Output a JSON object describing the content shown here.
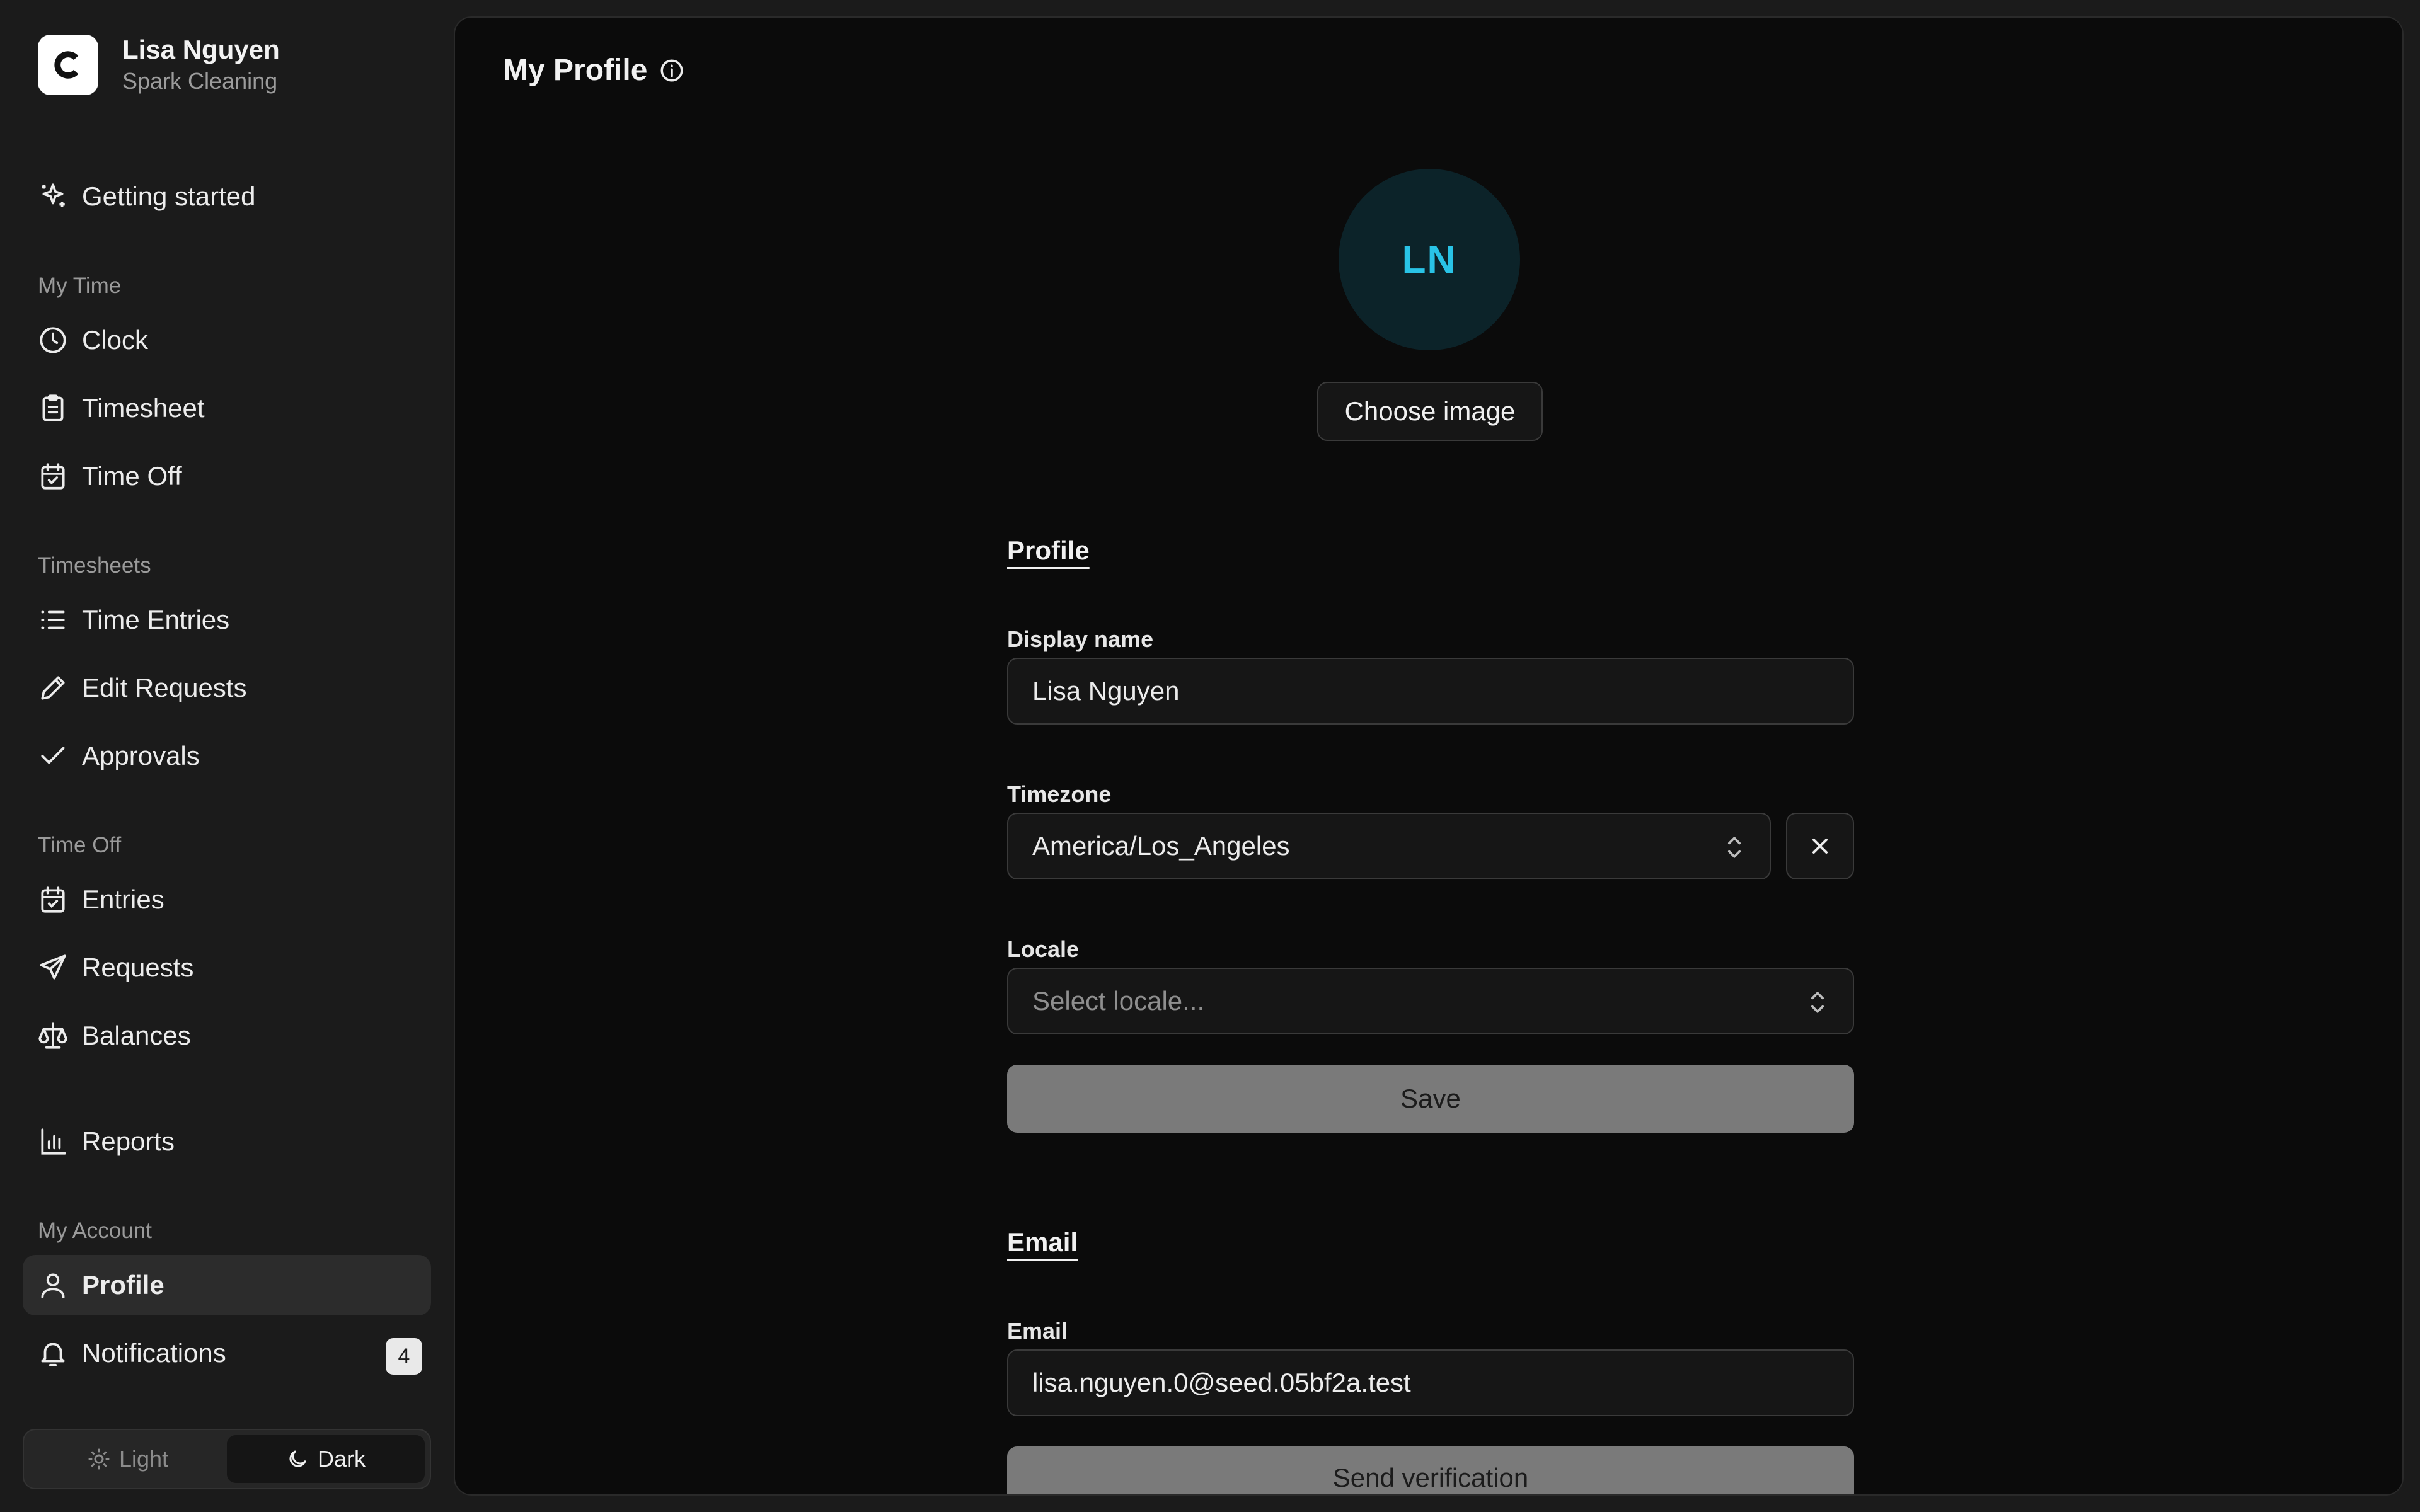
{
  "user": {
    "name": "Lisa Nguyen",
    "organization": "Spark Cleaning",
    "initials": "LN"
  },
  "sidebar": {
    "getting_started": "Getting started",
    "sections": [
      {
        "label": "My Time",
        "items": [
          {
            "label": "Clock",
            "icon": "clock-icon"
          },
          {
            "label": "Timesheet",
            "icon": "clipboard-icon"
          },
          {
            "label": "Time Off",
            "icon": "calendar-check-icon"
          }
        ]
      },
      {
        "label": "Timesheets",
        "items": [
          {
            "label": "Time Entries",
            "icon": "list-icon"
          },
          {
            "label": "Edit Requests",
            "icon": "pencil-icon"
          },
          {
            "label": "Approvals",
            "icon": "check-icon"
          }
        ]
      },
      {
        "label": "Time Off",
        "items": [
          {
            "label": "Entries",
            "icon": "calendar-check-icon"
          },
          {
            "label": "Requests",
            "icon": "send-icon"
          },
          {
            "label": "Balances",
            "icon": "scale-icon"
          }
        ]
      }
    ],
    "reports": "Reports",
    "account_section": "My Account",
    "profile": "Profile",
    "notifications": "Notifications",
    "notifications_count": "4",
    "theme": {
      "light": "Light",
      "dark": "Dark",
      "selected": "Dark"
    }
  },
  "main": {
    "title": "My Profile",
    "choose_image": "Choose image",
    "profile_section": {
      "heading": "Profile",
      "display_name_label": "Display name",
      "display_name_value": "Lisa Nguyen",
      "timezone_label": "Timezone",
      "timezone_value": "America/Los_Angeles",
      "locale_label": "Locale",
      "locale_placeholder": "Select locale...",
      "save": "Save"
    },
    "email_section": {
      "heading": "Email",
      "email_label": "Email",
      "email_value": "lisa.nguyen.0@seed.05bf2a.test",
      "send_verification": "Send verification"
    }
  },
  "colors": {
    "accent_avatar_text": "#29c3e6",
    "avatar_bg": "#0c2329",
    "background": "#0b0b0b",
    "sidebar": "#1b1b1b"
  }
}
